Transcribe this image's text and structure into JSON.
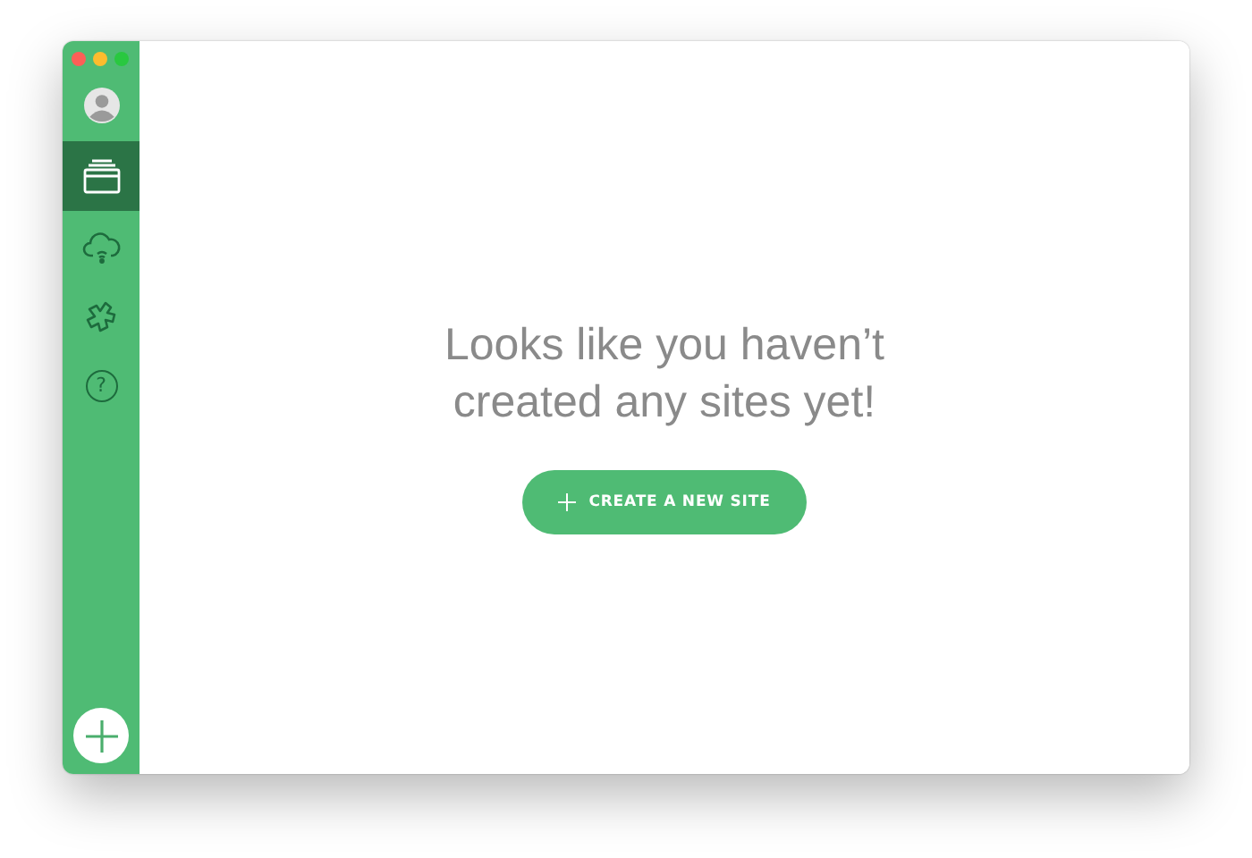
{
  "sidebar": {
    "items": [
      {
        "kind": "sites",
        "selected": true
      },
      {
        "kind": "cloud",
        "selected": false
      },
      {
        "kind": "addons",
        "selected": false
      },
      {
        "kind": "help",
        "label": "?",
        "selected": false
      }
    ]
  },
  "empty_state": {
    "message": "Looks like you haven’t created any sites yet!",
    "button": "CREATE A NEW SITE"
  }
}
